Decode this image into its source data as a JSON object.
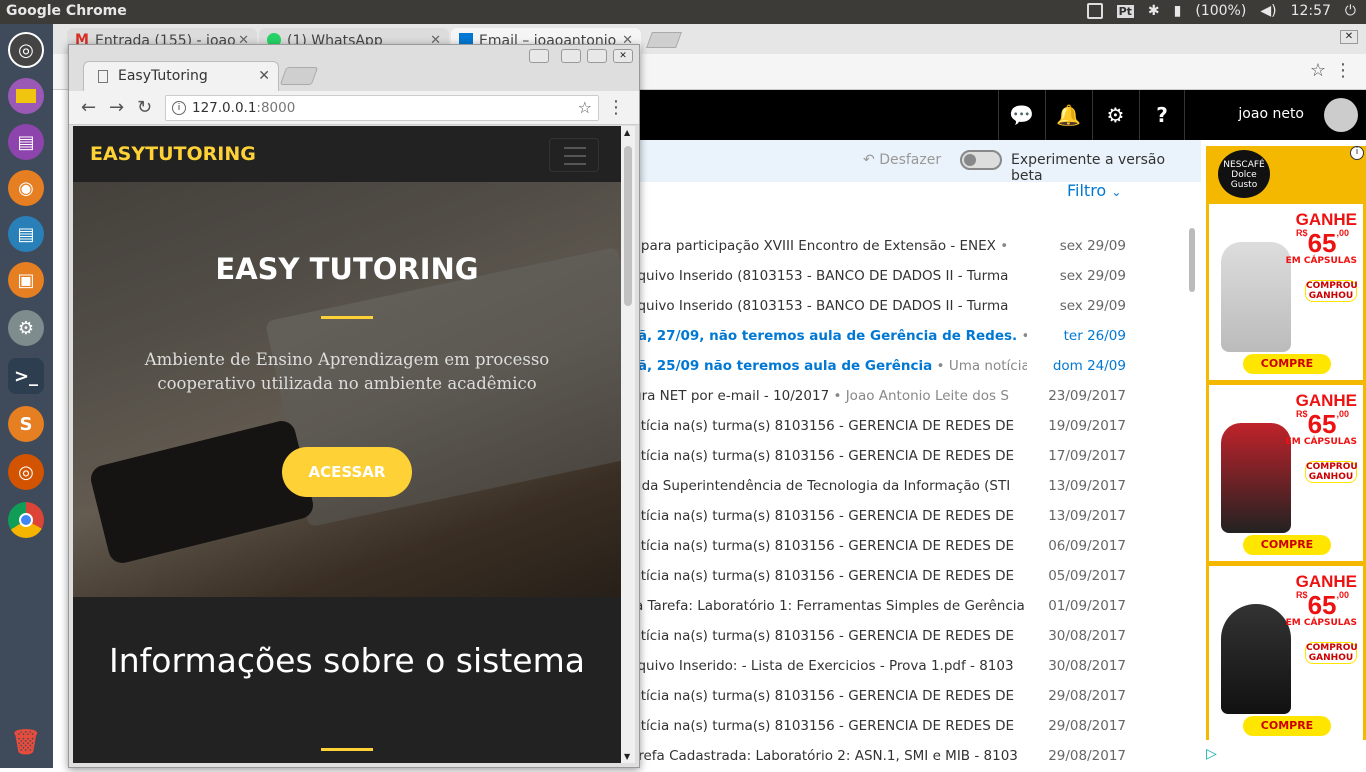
{
  "topbar": {
    "app_name": "Google Chrome",
    "battery": "(100%)",
    "time": "12:57",
    "keyboard": "Pt"
  },
  "back": {
    "tabs": [
      {
        "label": "Entrada (155) - joao"
      },
      {
        "label": "(1) WhatsApp"
      },
      {
        "label": "Email – joaoantonio"
      }
    ],
    "username": "joao neto",
    "undo": "Desfazer",
    "beta": "Experimente a versão beta",
    "filter": "Filtro",
    "emails": [
      {
        "subject": "Convite para participação XVIII Encontro de Extensão - ENEX",
        "preview": "",
        "date": "sex 29/09"
      },
      {
        "subject": "Novo arquivo Inserido (8103153 - BANCO DE DADOS II - Turma",
        "preview": "",
        "date": "sex 29/09"
      },
      {
        "subject": "Novo arquivo Inserido (8103153 - BANCO DE DADOS II - Turma",
        "preview": "",
        "date": "sex 29/09"
      },
      {
        "subject": "Amanhã, 27/09, não teremos aula de Gerência de Redes.",
        "preview": "Ur",
        "date": "ter 26/09"
      },
      {
        "subject": "Amanhã, 25/09 não teremos aula de Gerência",
        "preview": "Uma notícia fo",
        "date": "dom 24/09"
      },
      {
        "subject": "Sua fatura NET por e-mail - 10/2017",
        "preview": "Joao Antonio Leite dos S",
        "date": "23/09/2017"
      },
      {
        "subject": "Nova notícia na(s) turma(s) 8103156 - GERENCIA DE REDES DE",
        "preview": "",
        "date": "19/09/2017"
      },
      {
        "subject": "Nova notícia na(s) turma(s) 8103156 - GERENCIA DE REDES DE",
        "preview": "",
        "date": "17/09/2017"
      },
      {
        "subject": "Informe da Superintendência de Tecnologia da Informação (STI",
        "preview": "",
        "date": "13/09/2017"
      },
      {
        "subject": "Nova notícia na(s) turma(s) 8103156 - GERENCIA DE REDES DE",
        "preview": "",
        "date": "13/09/2017"
      },
      {
        "subject": "Nova notícia na(s) turma(s) 8103156 - GERENCIA DE REDES DE",
        "preview": "",
        "date": "06/09/2017"
      },
      {
        "subject": "Nova notícia na(s) turma(s) 8103156 - GERENCIA DE REDES DE",
        "preview": "",
        "date": "05/09/2017"
      },
      {
        "subject": "Envio da Tarefa: Laboratório 1: Ferramentas Simples de Gerência",
        "preview": "",
        "date": "01/09/2017"
      },
      {
        "subject": "Nova notícia na(s) turma(s) 8103156 - GERENCIA DE REDES DE",
        "preview": "",
        "date": "30/08/2017"
      },
      {
        "subject": "Novo arquivo Inserido: - Lista de Exercicios - Prova 1.pdf - 8103",
        "preview": "",
        "date": "30/08/2017"
      },
      {
        "subject": "Nova notícia na(s) turma(s) 8103156 - GERENCIA DE REDES DE",
        "preview": "",
        "date": "29/08/2017"
      },
      {
        "subject": "Nova notícia na(s) turma(s) 8103156 - GERENCIA DE REDES DE",
        "preview": "",
        "date": "29/08/2017"
      },
      {
        "subject": "Nova Tarefa Cadastrada: Laboratório 2: ASN.1, SMI e MIB - 8103",
        "preview": "",
        "date": "29/08/2017"
      }
    ],
    "ad": {
      "logo": "NESCAFÉ Dolce Gusto",
      "ganhe": "GANHE",
      "currency": "R$",
      "price": "65",
      "cents": ",00",
      "caps": "EM CÁPSULAS",
      "cta": "COMPRE",
      "comprou": "COMPROU GANHOU"
    }
  },
  "front": {
    "tab_title": "EasyTutoring",
    "url_host": "127.0.0.1",
    "url_port": ":8000",
    "brand": "EASYTUTORING",
    "hero_title": "EASY TUTORING",
    "hero_subtitle": "Ambiente de Ensino Aprendizagem em processo cooperativo utilizada no ambiente acadêmico",
    "cta": "ACESSAR",
    "section_title": "Informações sobre o sistema"
  },
  "colors": {
    "accent": "#fed136",
    "outlook_blue": "#0078d4"
  }
}
